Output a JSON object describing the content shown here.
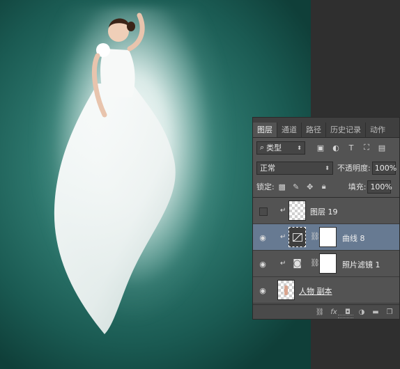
{
  "panel": {
    "tabs": [
      "图层",
      "通道",
      "路径",
      "历史记录",
      "动作"
    ],
    "filter_type": "类型",
    "blend_mode": "正常",
    "opacity_label": "不透明度:",
    "opacity_value": "100%",
    "lock_label": "锁定:",
    "fill_label": "填充:",
    "fill_value": "100%",
    "layers": [
      {
        "name": "图层 19",
        "visible": false,
        "clipped": true,
        "thumb": "transparent",
        "selected": false
      },
      {
        "name": "曲线 8",
        "visible": true,
        "clipped": true,
        "thumb": "curves-adjustment",
        "mask": true,
        "selected": true
      },
      {
        "name": "照片滤镜 1",
        "visible": true,
        "clipped": true,
        "thumb": "photo-filter-adjustment",
        "mask": true,
        "selected": false
      },
      {
        "name": "人物 副本",
        "visible": true,
        "clipped": false,
        "thumb": "person-layer",
        "selected": false
      }
    ],
    "footer_icons": [
      "link-layers-icon",
      "fx-icon",
      "add-mask-icon",
      "adjustment-layer-icon",
      "new-group-icon",
      "new-layer-icon"
    ]
  }
}
